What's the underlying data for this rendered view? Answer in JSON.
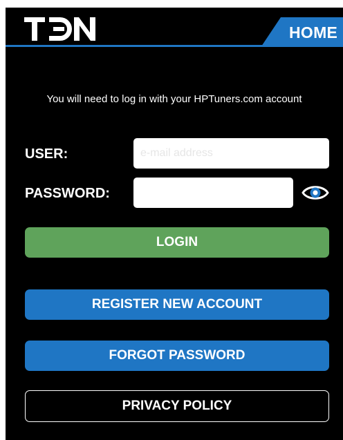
{
  "header": {
    "logo_text": "TDN",
    "home_label": "HOME"
  },
  "login": {
    "instruction": "You will need to log in with your HPTuners.com account",
    "user_label": "USER:",
    "user_placeholder": "e-mail address",
    "user_value": "",
    "password_label": "PASSWORD:",
    "password_value": ""
  },
  "buttons": {
    "login": "LOGIN",
    "register": "REGISTER NEW ACCOUNT",
    "forgot": "FORGOT PASSWORD",
    "privacy": "PRIVACY POLICY"
  },
  "icons": {
    "password_toggle": "eye-icon",
    "logo": "tdn-logo"
  },
  "colors": {
    "background": "#000000",
    "accent_blue": "#1f76c4",
    "login_green": "#5fa35b",
    "text": "#ffffff"
  }
}
